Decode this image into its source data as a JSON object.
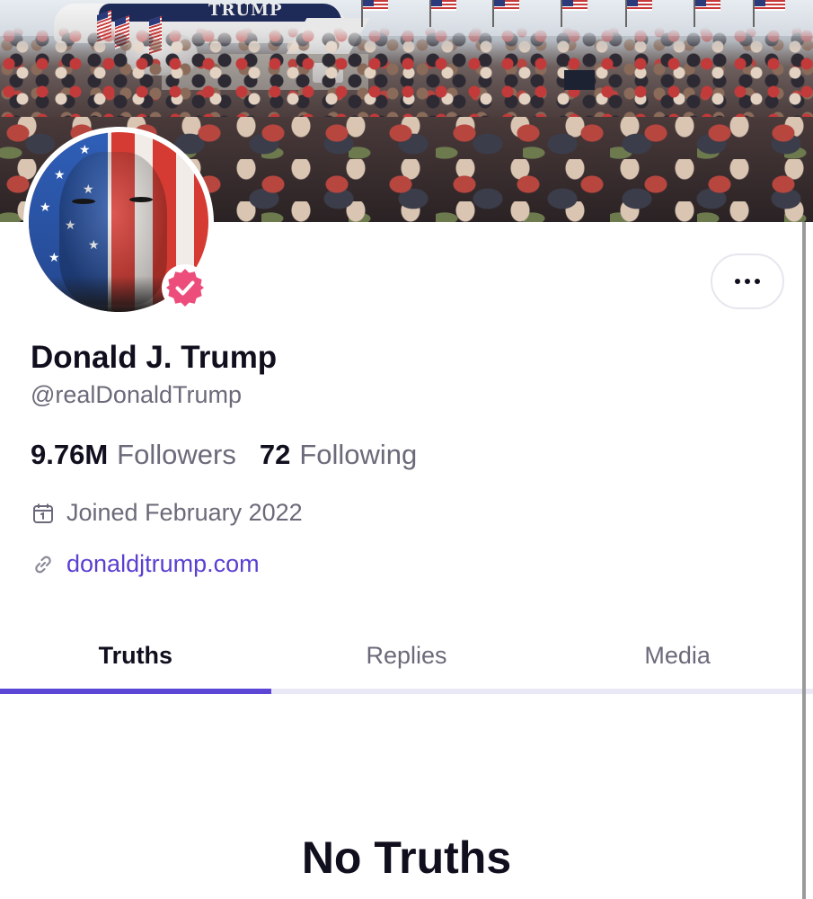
{
  "banner": {
    "plane_text": "TRUMP",
    "colors": {
      "flag_red": "#c83a3a",
      "flag_blue": "#2a3a7a",
      "plane_stripe": "#1e2a57"
    }
  },
  "profile": {
    "avatar_icon": "avatar",
    "verified_icon": "verified-badge-icon",
    "verified_color": "#ec4d7a",
    "display_name": "Donald J. Trump",
    "handle": "@realDonaldTrump",
    "followers_count": "9.76M",
    "followers_label": "Followers",
    "following_count": "72",
    "following_label": "Following",
    "joined_icon": "calendar-icon",
    "joined_text": "Joined February 2022",
    "website_icon": "link-icon",
    "website_text": "donaldjtrump.com",
    "link_color": "#5a3fd1"
  },
  "actions": {
    "more_icon": "more-options-icon"
  },
  "tabs": [
    {
      "label": "Truths",
      "active": true
    },
    {
      "label": "Replies",
      "active": false
    },
    {
      "label": "Media",
      "active": false
    }
  ],
  "accent_color": "#5b46d6",
  "empty_state": {
    "title": "No Truths"
  }
}
